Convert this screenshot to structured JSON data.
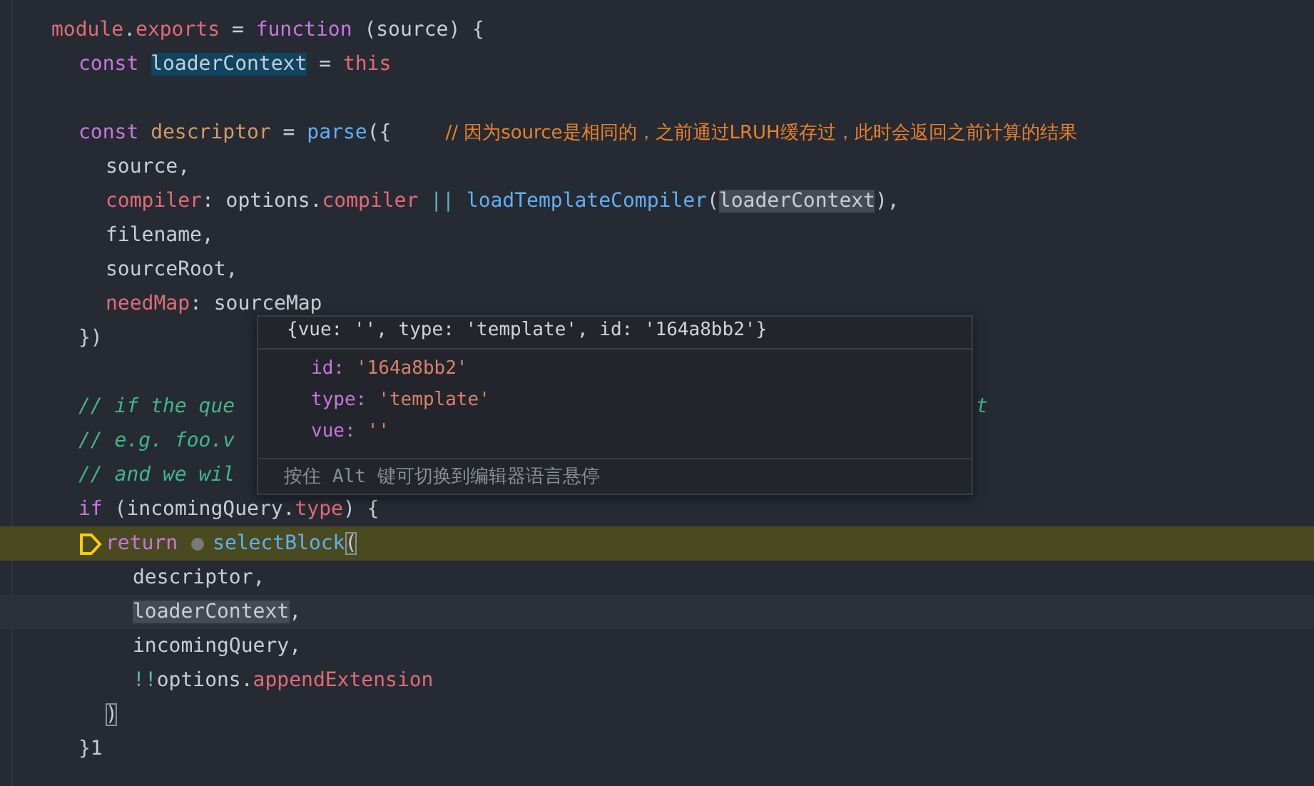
{
  "editor": {
    "lines": [
      {
        "tokens": [
          {
            "text": "module",
            "kind": "prop"
          },
          {
            "text": ".",
            "kind": "plain"
          },
          {
            "text": "exports",
            "kind": "prop"
          },
          {
            "text": " = ",
            "kind": "plain"
          },
          {
            "text": "function",
            "kind": "keyword"
          },
          {
            "text": " (source) {",
            "kind": "plain"
          }
        ],
        "children": [
          {
            "tokens": [
              {
                "text": "const ",
                "kind": "keyword"
              },
              {
                "text": "loaderContext",
                "kind": "plain",
                "selection": true
              },
              {
                "text": " = ",
                "kind": "plain"
              },
              {
                "text": "this",
                "kind": "prop"
              }
            ]
          },
          {
            "gap_before": true,
            "tokens": [
              {
                "text": "const ",
                "kind": "keyword"
              },
              {
                "text": "descriptor",
                "kind": "var"
              },
              {
                "text": " = ",
                "kind": "plain"
              },
              {
                "text": "parse",
                "kind": "func"
              },
              {
                "text": "({",
                "kind": "plain"
              },
              {
                "text": "// 因为source是相同的，之前通过LRUH缓存过，此时会返回之前计算的结果",
                "kind": "annotation"
              }
            ],
            "children": [
              {
                "tokens": [
                  {
                    "text": "source,",
                    "kind": "plain"
                  }
                ]
              },
              {
                "tokens": [
                  {
                    "text": "compiler",
                    "kind": "prop"
                  },
                  {
                    "text": ": options.",
                    "kind": "plain"
                  },
                  {
                    "text": "compiler ",
                    "kind": "prop"
                  },
                  {
                    "text": "|| ",
                    "kind": "op"
                  },
                  {
                    "text": "loadTemplateCompiler",
                    "kind": "func"
                  },
                  {
                    "text": "(",
                    "kind": "plain"
                  },
                  {
                    "text": "loaderContext",
                    "kind": "plain",
                    "occurrence": true
                  },
                  {
                    "text": "),",
                    "kind": "plain"
                  }
                ]
              },
              {
                "tokens": [
                  {
                    "text": "filename,",
                    "kind": "plain"
                  }
                ]
              },
              {
                "tokens": [
                  {
                    "text": "sourceRoot,",
                    "kind": "plain"
                  }
                ]
              },
              {
                "tokens": [
                  {
                    "text": "needMap",
                    "kind": "prop"
                  },
                  {
                    "text": ": sourceMap",
                    "kind": "plain"
                  }
                ]
              }
            ]
          },
          {
            "tokens": [
              {
                "text": "})",
                "kind": "plain"
              }
            ]
          },
          {
            "gap_before": true,
            "tokens": [
              {
                "text": "// if the que",
                "kind": "comment"
              },
              {
                "text": "t",
                "kind": "comment-after-popup"
              }
            ]
          },
          {
            "tokens": [
              {
                "text": "// e.g. foo.v",
                "kind": "comment"
              }
            ]
          },
          {
            "tokens": [
              {
                "text": "// and we wil",
                "kind": "comment"
              }
            ]
          },
          {
            "tokens": [
              {
                "text": "if ",
                "kind": "keyword"
              },
              {
                "text": "(incomingQuery.",
                "kind": "plain"
              },
              {
                "text": "type",
                "kind": "prop"
              },
              {
                "text": ") {",
                "kind": "plain"
              }
            ],
            "children": [
              {
                "paused": true,
                "tokens": [
                  {
                    "kind": "debug-arrow"
                  },
                  {
                    "text": "return ",
                    "kind": "keyword"
                  },
                  {
                    "kind": "inline-breakpoint"
                  },
                  {
                    "text": "selectBlock",
                    "kind": "func"
                  },
                  {
                    "text": "(",
                    "kind": "plain",
                    "bracket_match": true
                  }
                ],
                "children": [
                  {
                    "tokens": [
                      {
                        "text": "descriptor,",
                        "kind": "plain"
                      }
                    ]
                  },
                  {
                    "cursor": true,
                    "tokens": [
                      {
                        "text": "loaderContext",
                        "kind": "plain",
                        "occurrence": true
                      },
                      {
                        "text": ",",
                        "kind": "plain"
                      }
                    ]
                  },
                  {
                    "tokens": [
                      {
                        "text": "incomingQuery,",
                        "kind": "plain"
                      }
                    ]
                  },
                  {
                    "tokens": [
                      {
                        "text": "!!",
                        "kind": "op"
                      },
                      {
                        "text": "options.",
                        "kind": "plain"
                      },
                      {
                        "text": "appendExtension",
                        "kind": "prop"
                      }
                    ]
                  }
                ]
              },
              {
                "tokens": [
                  {
                    "text": ")",
                    "kind": "plain",
                    "bracket_match": true
                  }
                ]
              }
            ]
          },
          {
            "tokens": [
              {
                "text": "}1",
                "kind": "plain"
              }
            ]
          }
        ]
      }
    ]
  },
  "hover": {
    "header": "{vue: '', type: 'template', id: '164a8bb2'}",
    "properties": [
      {
        "key": "id:",
        "value": "'164a8bb2'"
      },
      {
        "key": "type:",
        "value": "'template'"
      },
      {
        "key": "vue:",
        "value": "''"
      }
    ],
    "hint": [
      {
        "text": "按住",
        "kind": "text"
      },
      {
        "text": "Alt",
        "kind": "key"
      },
      {
        "text": "键可切换到编辑器语言悬停",
        "kind": "text"
      }
    ]
  }
}
